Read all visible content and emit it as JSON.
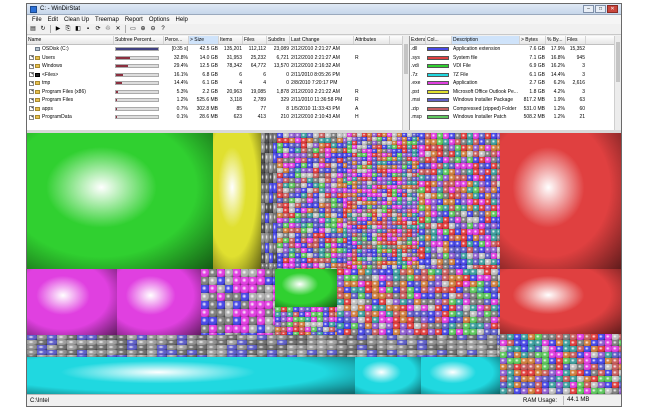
{
  "window": {
    "title": "C: - WinDirStat"
  },
  "menu": [
    "File",
    "Edit",
    "Clean Up",
    "Treemap",
    "Report",
    "Options",
    "Help"
  ],
  "toolbar": [
    {
      "icon": "open-folder-icon",
      "glyph": "▤"
    },
    {
      "icon": "refresh-icon",
      "glyph": "↻"
    },
    {
      "icon": "play-icon",
      "glyph": "▶"
    },
    {
      "icon": "copy-path-icon",
      "glyph": "⎘"
    },
    {
      "icon": "explorer-icon",
      "glyph": "◧"
    },
    {
      "icon": "command-prompt-icon",
      "glyph": "▪"
    },
    {
      "icon": "refresh-selected-icon",
      "glyph": "⟳"
    },
    {
      "icon": "recycle-bin-icon",
      "glyph": "♲"
    },
    {
      "icon": "delete-icon",
      "glyph": "✕"
    },
    {
      "icon": "new-window-icon",
      "glyph": "▭"
    },
    {
      "icon": "zoom-in-icon",
      "glyph": "⊕"
    },
    {
      "icon": "zoom-out-icon",
      "glyph": "⊖"
    },
    {
      "icon": "help-icon",
      "glyph": "?"
    }
  ],
  "tree": {
    "columns": [
      "Name",
      "Subtree Percent...",
      "Perce...",
      "> Size",
      "Items",
      "Files",
      "Subdirs",
      "Last Change",
      "Attributes"
    ],
    "rows": [
      {
        "name": "OSDisk (C:)",
        "expander": "",
        "icon": "drive",
        "bar": 100,
        "perc": "[0:35 s]",
        "size": "42.5 GB",
        "items": "135,201",
        "files": "112,112",
        "subdirs": "23,089",
        "last_change": "2/12/2010  2:21:27 AM",
        "attr": ""
      },
      {
        "name": "Users",
        "expander": "+",
        "icon": "folder",
        "bar": 32.8,
        "perc": "32.8%",
        "size": "14.0 GB",
        "items": "31,953",
        "files": "25,232",
        "subdirs": "6,721",
        "last_change": "2/12/2010  2:21:27 AM",
        "attr": "R"
      },
      {
        "name": "Windows",
        "expander": "+",
        "icon": "folder",
        "bar": 29.4,
        "perc": "29.4%",
        "size": "12.5 GB",
        "items": "78,342",
        "files": "64,772",
        "subdirs": "13,570",
        "last_change": "2/12/2010  2:16:32 AM",
        "attr": ""
      },
      {
        "name": "<Files>",
        "expander": "+",
        "icon": "dark",
        "bar": 16.1,
        "perc": "16.1%",
        "size": "6.8 GB",
        "items": "6",
        "files": "6",
        "subdirs": "0",
        "last_change": "2/11/2010  8:05:26 PM",
        "attr": ""
      },
      {
        "name": "tmp",
        "expander": "+",
        "icon": "folder",
        "bar": 14.4,
        "perc": "14.4%",
        "size": "6.1 GB",
        "items": "4",
        "files": "4",
        "subdirs": "0",
        "last_change": "2/8/2010  7:20:17 PM",
        "attr": ""
      },
      {
        "name": "Program Files (x86)",
        "expander": "+",
        "icon": "folder",
        "bar": 5.3,
        "perc": "5.3%",
        "size": "2.2 GB",
        "items": "20,963",
        "files": "19,085",
        "subdirs": "1,878",
        "last_change": "2/12/2010  2:21:22 AM",
        "attr": "R"
      },
      {
        "name": "Program Files",
        "expander": "+",
        "icon": "folder",
        "bar": 1.2,
        "perc": "1.2%",
        "size": "525.6 MB",
        "items": "3,118",
        "files": "2,789",
        "subdirs": "329",
        "last_change": "2/11/2010  11:36:58 PM",
        "attr": "R"
      },
      {
        "name": "apps",
        "expander": "+",
        "icon": "folder",
        "bar": 0.7,
        "perc": "0.7%",
        "size": "302.8 MB",
        "items": "85",
        "files": "77",
        "subdirs": "8",
        "last_change": "1/5/2010  11:33:43 PM",
        "attr": "A"
      },
      {
        "name": "ProgramData",
        "expander": "+",
        "icon": "folder",
        "bar": 0.1,
        "perc": "0.1%",
        "size": "28.6 MB",
        "items": "623",
        "files": "413",
        "subdirs": "210",
        "last_change": "2/12/2010  2:10:43 AM",
        "attr": "H"
      }
    ]
  },
  "extensions": {
    "columns": [
      "Extensi...",
      "Col...",
      "Description",
      "> Bytes",
      "% By...",
      "Files"
    ],
    "rows": [
      {
        "ext": ".dll",
        "color": "#4a4ae6",
        "desc": "Application extension",
        "bytes": "7.6 GB",
        "pct": "17.9%",
        "files": "15,352"
      },
      {
        "ext": ".sys",
        "color": "#e04040",
        "desc": "System file",
        "bytes": "7.1 GB",
        "pct": "16.8%",
        "files": "945"
      },
      {
        "ext": ".vdi",
        "color": "#30d030",
        "desc": "VDI File",
        "bytes": "6.9 GB",
        "pct": "16.2%",
        "files": "3"
      },
      {
        "ext": ".7z",
        "color": "#20d8e0",
        "desc": "7Z File",
        "bytes": "6.1 GB",
        "pct": "14.4%",
        "files": "3"
      },
      {
        "ext": ".exe",
        "color": "#e040e0",
        "desc": "Application",
        "bytes": "2.7 GB",
        "pct": "6.2%",
        "files": "2,616"
      },
      {
        "ext": ".pst",
        "color": "#e0e030",
        "desc": "Microsoft Office Outlook Pe...",
        "bytes": "1.8 GB",
        "pct": "4.2%",
        "files": "3"
      },
      {
        "ext": ".msi",
        "color": "#6060c8",
        "desc": "Windows Installer Package",
        "bytes": "817.2 MB",
        "pct": "1.9%",
        "files": "63"
      },
      {
        "ext": ".zip",
        "color": "#c86060",
        "desc": "Compressed (zipped) Folder",
        "bytes": "531.0 MB",
        "pct": "1.2%",
        "files": "60"
      },
      {
        "ext": ".msp",
        "color": "#60c860",
        "desc": "Windows Installer Patch",
        "bytes": "508.2 MB",
        "pct": "1.2%",
        "files": "21"
      }
    ]
  },
  "status": {
    "path": "C:\\Intel",
    "ram_label": "RAM Usage:",
    "ram_value": "44.1 MB"
  }
}
